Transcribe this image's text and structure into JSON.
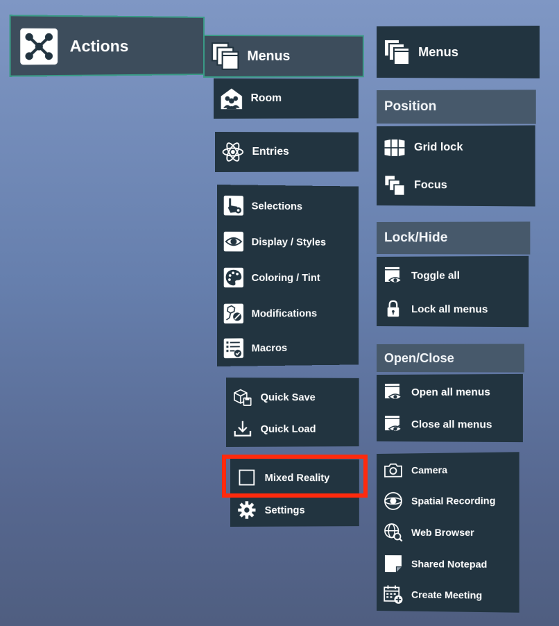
{
  "actions": {
    "label": "Actions",
    "icon": "actions-network-icon"
  },
  "column_main": {
    "menus": {
      "label": "Menus",
      "icon": "menus-stack-icon"
    },
    "groups": [
      [
        {
          "id": "room",
          "label": "Room",
          "icon": "room-people-icon"
        }
      ],
      [
        {
          "id": "entries",
          "label": "Entries",
          "icon": "atom-icon"
        }
      ],
      [
        {
          "id": "selections",
          "label": "Selections",
          "icon": "selection-hand-icon"
        },
        {
          "id": "display-styles",
          "label": "Display / Styles",
          "icon": "eye-icon"
        },
        {
          "id": "coloring-tint",
          "label": "Coloring / Tint",
          "icon": "palette-icon"
        },
        {
          "id": "modifications",
          "label": "Modifications",
          "icon": "modify-molecule-icon"
        },
        {
          "id": "macros",
          "label": "Macros",
          "icon": "checklist-icon"
        }
      ],
      [
        {
          "id": "quick-save",
          "label": "Quick Save",
          "icon": "save-box-icon"
        },
        {
          "id": "quick-load",
          "label": "Quick Load",
          "icon": "download-icon"
        }
      ],
      [
        {
          "id": "mixed-reality",
          "label": "Mixed Reality",
          "icon": "square-icon"
        },
        {
          "id": "settings",
          "label": "Settings",
          "icon": "gear-icon"
        }
      ]
    ]
  },
  "column_right": {
    "menus": {
      "label": "Menus",
      "icon": "menus-stack-icon"
    },
    "position": {
      "header": "Position",
      "items": [
        {
          "id": "grid-lock",
          "label": "Grid lock",
          "icon": "grid-panels-icon"
        },
        {
          "id": "focus",
          "label": "Focus",
          "icon": "focus-stack-icon"
        }
      ]
    },
    "lock_hide": {
      "header": "Lock/Hide",
      "items": [
        {
          "id": "toggle-all",
          "label": "Toggle all",
          "icon": "window-eye-icon"
        },
        {
          "id": "lock-all-menus",
          "label": "Lock all menus",
          "icon": "lock-icon"
        }
      ]
    },
    "open_close": {
      "header": "Open/Close",
      "items": [
        {
          "id": "open-all-menus",
          "label": "Open all menus",
          "icon": "window-eye-icon"
        },
        {
          "id": "close-all-menus",
          "label": "Close all menus",
          "icon": "window-eye-off-icon"
        }
      ]
    },
    "tools": [
      {
        "id": "camera",
        "label": "Camera",
        "icon": "camera-icon"
      },
      {
        "id": "spatial-recording",
        "label": "Spatial Recording",
        "icon": "spatial-recording-icon"
      },
      {
        "id": "web-browser",
        "label": "Web Browser",
        "icon": "globe-search-icon"
      },
      {
        "id": "shared-notepad",
        "label": "Shared Notepad",
        "icon": "notepad-icon"
      },
      {
        "id": "create-meeting",
        "label": "Create Meeting",
        "icon": "calendar-add-icon"
      }
    ]
  }
}
